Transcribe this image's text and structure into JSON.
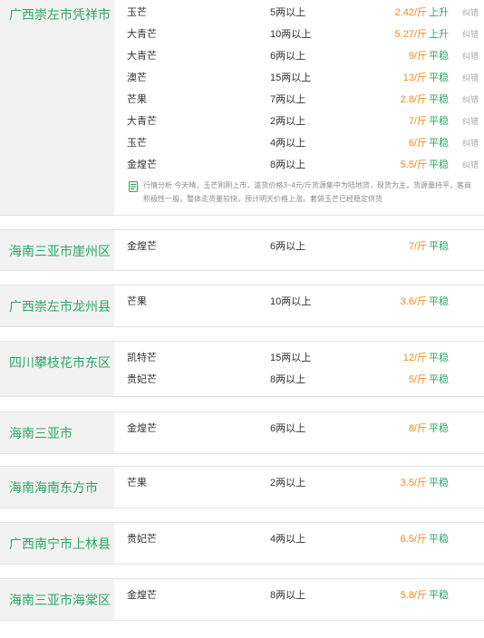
{
  "markets": [
    {
      "region": "广西崇左市凭祥市",
      "rows": [
        {
          "variety": "玉芒",
          "size": "5两以上",
          "price": "2.42/斤",
          "trend": "上升",
          "correct": "纠错"
        },
        {
          "variety": "大青芒",
          "size": "10两以上",
          "price": "5.27/斤",
          "trend": "上升",
          "correct": "纠错"
        },
        {
          "variety": "大青芒",
          "size": "6两以上",
          "price": "9/斤",
          "trend": "平稳",
          "correct": "纠错"
        },
        {
          "variety": "澳芒",
          "size": "15两以上",
          "price": "13/斤",
          "trend": "平稳",
          "correct": "纠错"
        },
        {
          "variety": "芒果",
          "size": "7两以上",
          "price": "2.8/斤",
          "trend": "平稳",
          "correct": "纠错"
        },
        {
          "variety": "大青芒",
          "size": "2两以上",
          "price": "7/斤",
          "trend": "平稳",
          "correct": "纠错"
        },
        {
          "variety": "玉芒",
          "size": "4两以上",
          "price": "6/斤",
          "trend": "平稳",
          "correct": "纠错"
        },
        {
          "variety": "金煌芒",
          "size": "8两以上",
          "price": "5.5/斤",
          "trend": "平稳",
          "correct": "纠错"
        }
      ],
      "analysis": "行情分析 今天晴，玉芒刚刚上市，滥货价格3~4元/斤货源集中为陆地货，现货为主，货源量持平，客商积极性一般，整体走货量较快，预计明天价格上涨。套袋玉芒已经稳定供货"
    },
    {
      "region": "海南三亚市崖州区",
      "rows": [
        {
          "variety": "金煌芒",
          "size": "6两以上",
          "price": "7/斤",
          "trend": "平稳"
        }
      ]
    },
    {
      "region": "广西崇左市龙州县",
      "rows": [
        {
          "variety": "芒果",
          "size": "10两以上",
          "price": "3.6/斤",
          "trend": "平稳"
        }
      ]
    },
    {
      "region": "四川攀枝花市东区",
      "rows": [
        {
          "variety": "凯特芒",
          "size": "15两以上",
          "price": "12/斤",
          "trend": "平稳"
        },
        {
          "variety": "贵妃芒",
          "size": "8两以上",
          "price": "5/斤",
          "trend": "平稳"
        }
      ]
    },
    {
      "region": "海南三亚市",
      "rows": [
        {
          "variety": "金煌芒",
          "size": "6两以上",
          "price": "8/斤",
          "trend": "平稳"
        }
      ]
    },
    {
      "region": "海南海南东方市",
      "rows": [
        {
          "variety": "芒果",
          "size": "2两以上",
          "price": "3.5/斤",
          "trend": "平稳"
        }
      ]
    },
    {
      "region": "广西南宁市上林县",
      "rows": [
        {
          "variety": "贵妃芒",
          "size": "4两以上",
          "price": "6.5/斤",
          "trend": "平稳"
        }
      ]
    },
    {
      "region": "海南三亚市海棠区",
      "rows": [
        {
          "variety": "金煌芒",
          "size": "8两以上",
          "price": "5.8/斤",
          "trend": "平稳"
        }
      ]
    }
  ],
  "colors": {
    "region_green": "#2aa76a",
    "price_orange": "#f08a24",
    "trend_green": "#2aa76a",
    "region_bg": "#f2f2f2"
  },
  "icons": {
    "analysis": "note-icon"
  }
}
